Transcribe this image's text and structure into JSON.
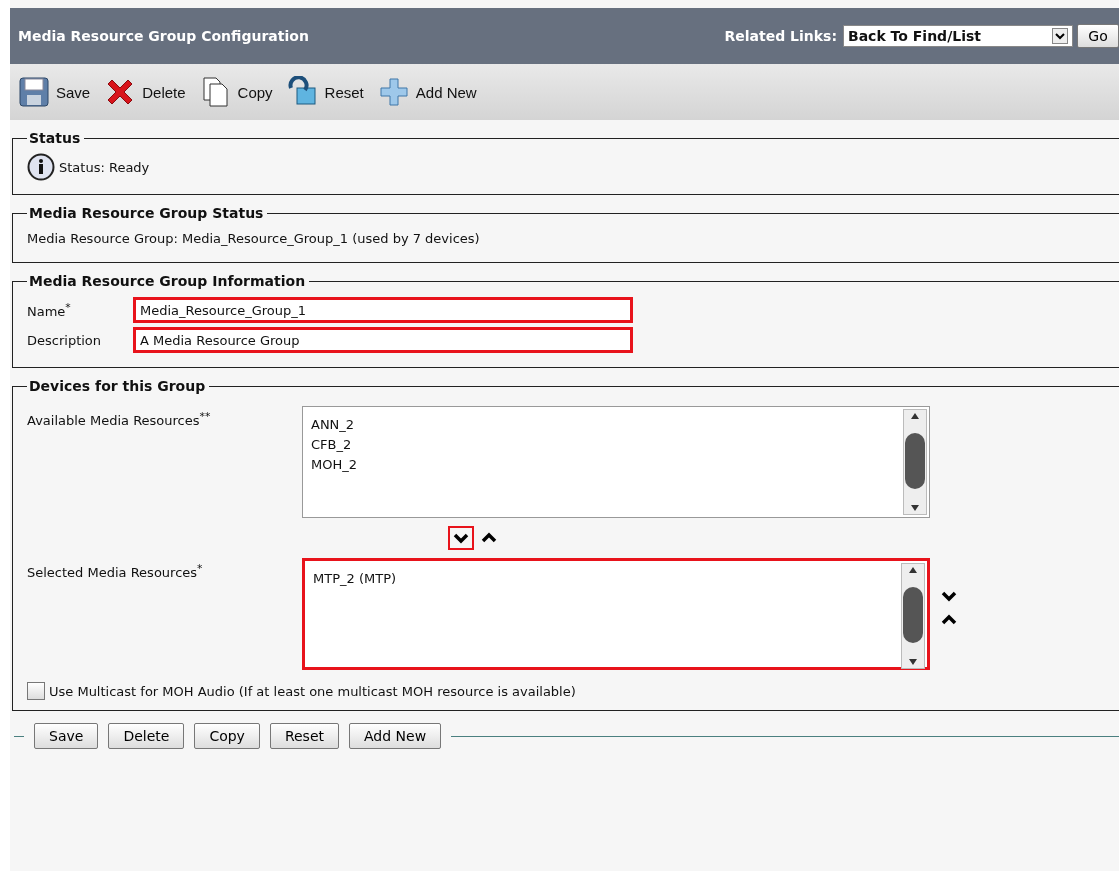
{
  "header": {
    "title": "Media Resource Group Configuration",
    "related_links_label": "Related Links:",
    "related_links_value": "Back To Find/List",
    "go_button": "Go"
  },
  "toolbar": [
    {
      "kind": "save",
      "label": "Save"
    },
    {
      "kind": "delete",
      "label": "Delete"
    },
    {
      "kind": "copy",
      "label": "Copy"
    },
    {
      "kind": "reset",
      "label": "Reset"
    },
    {
      "kind": "add",
      "label": "Add New"
    }
  ],
  "status": {
    "title": "Status",
    "message": "Status: Ready"
  },
  "group_status": {
    "title": "Media Resource Group Status",
    "text": "Media Resource Group: Media_Resource_Group_1 (used by 7 devices)"
  },
  "information": {
    "title": "Media Resource Group Information",
    "fields": [
      {
        "label": "Name$^{*}$",
        "value": "Media_Resource_Group_1",
        "highlighted": true
      },
      {
        "label": "Description",
        "value": "A Media Resource Group",
        "highlighted": true
      }
    ]
  },
  "devices": {
    "title": "Devices for this Group",
    "available": {
      "label": "Available Media Resources$^{**}$",
      "items": [
        "ANN_2",
        "CFB_2",
        "MOH_2"
      ],
      "highlighted": false
    },
    "move_buttons": [
      {
        "kind": "down",
        "highlighted": true
      },
      {
        "kind": "up",
        "highlighted": false
      }
    ],
    "selected": {
      "label": "Selected Media Resources$^{*}$",
      "items": [
        "MTP_2 (MTP)"
      ],
      "highlighted": true
    },
    "order_buttons": [
      {
        "kind": "down"
      },
      {
        "kind": "up"
      }
    ],
    "multicast": {
      "label": "Use Multicast for MOH Audio (If at least one multicast MOH resource is available)",
      "checked": false
    }
  },
  "bottom_buttons": [
    "Save",
    "Delete",
    "Copy",
    "Reset",
    "Add New"
  ]
}
